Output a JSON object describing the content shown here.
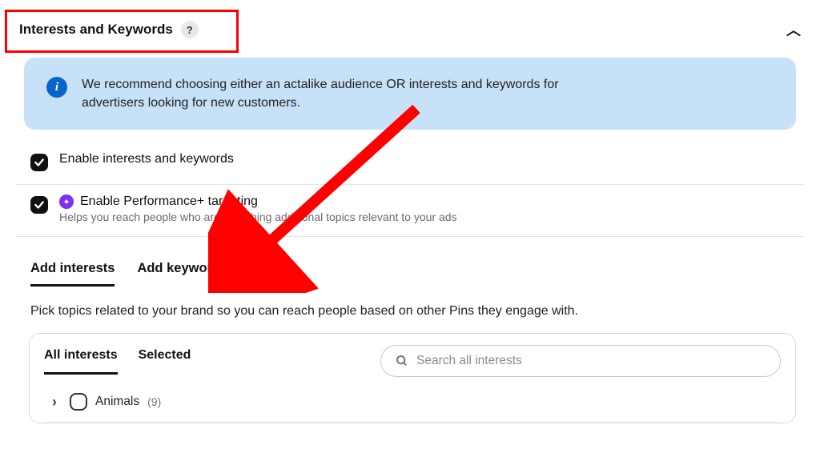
{
  "header": {
    "title": "Interests and Keywords"
  },
  "banner": {
    "text": "We recommend choosing either an actalike audience OR interests and keywords for advertisers looking for new customers."
  },
  "options": {
    "enable_interests_label": "Enable interests and keywords",
    "perf_plus_label": "Enable Performance+ targeting",
    "perf_plus_desc": "Helps you reach people who are searching additional topics relevant to your ads"
  },
  "tabs": {
    "add_interests": "Add interests",
    "add_keywords": "Add keywords",
    "description": "Pick topics related to your brand so you can reach people based on other Pins they engage with."
  },
  "interests_panel": {
    "tab_all": "All interests",
    "tab_selected": "Selected",
    "search_placeholder": "Search all interests",
    "categories": [
      {
        "name": "Animals",
        "count": "(9)"
      }
    ]
  }
}
